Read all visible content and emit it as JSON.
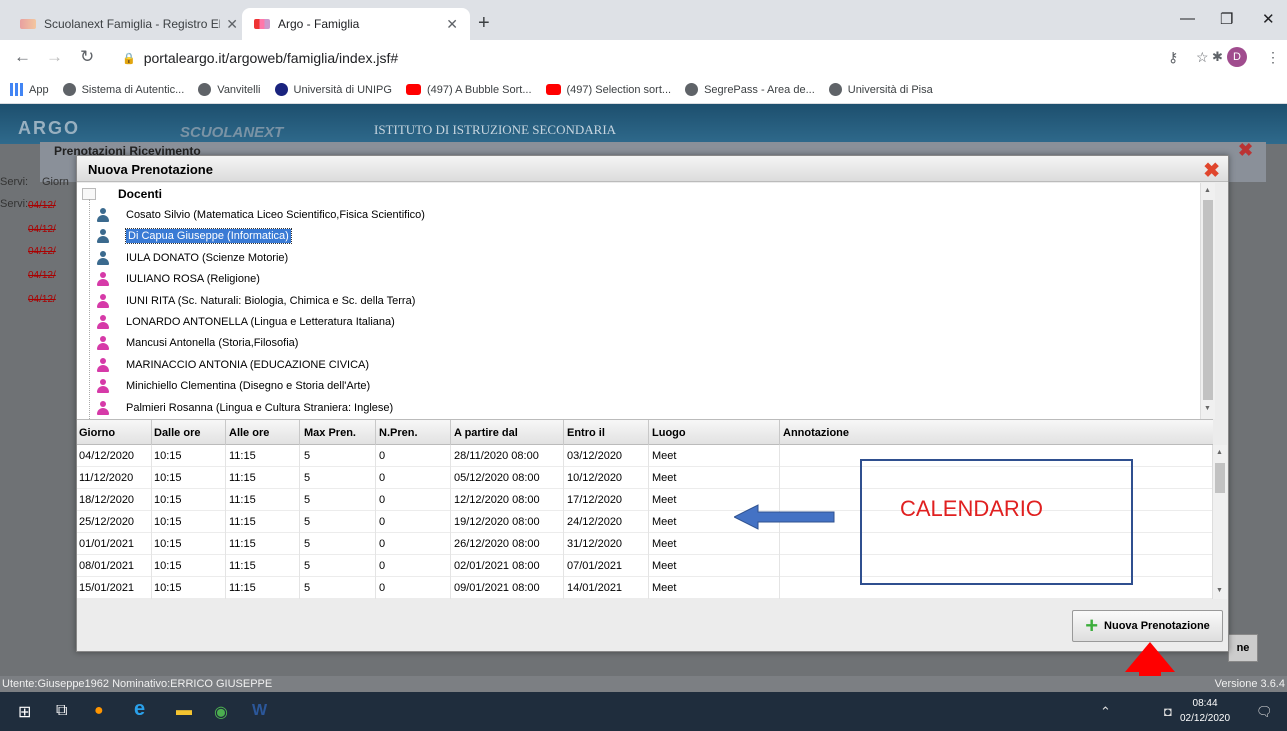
{
  "browser": {
    "tabs": [
      {
        "title": "Scuolanext Famiglia - Registro El",
        "active": false
      },
      {
        "title": "Argo - Famiglia",
        "active": true
      }
    ],
    "url": "portaleargo.it/argoweb/famiglia/index.jsf#",
    "avatar_letter": "D",
    "bookmarks": [
      "App",
      "Sistema di Autentic...",
      "Vanvitelli",
      "Università di UNIPG",
      "(497) A Bubble Sort...",
      "(497) Selection sort...",
      "SegrePass - Area de...",
      "Università di Pisa"
    ]
  },
  "app": {
    "logo": "ARGO",
    "logo_sub": "SCUOLANEXT",
    "institute": "ISTITUTO DI ISTRUZIONE SECONDARIA",
    "background_panel_title": "Prenotazioni Ricevimento",
    "left_labels": [
      "Servi:",
      "Giorn",
      "Servi:"
    ],
    "left_dates": [
      "04/12/",
      "04/12/",
      "04/12/",
      "04/12/",
      "04/12/"
    ],
    "bg_button_label": "ne"
  },
  "modal": {
    "title": "Nuova Prenotazione",
    "tree_root": "Docenti",
    "teachers": [
      {
        "name": "Cosato Silvio (Matematica Liceo Scientifico,Fisica Scientifico)",
        "gender": "m"
      },
      {
        "name": "Di Capua Giuseppe (Informatica)",
        "gender": "m",
        "selected": true
      },
      {
        "name": "IULA DONATO (Scienze Motorie)",
        "gender": "m"
      },
      {
        "name": "IULIANO ROSA (Religione)",
        "gender": "f"
      },
      {
        "name": "IUNI RITA (Sc. Naturali: Biologia, Chimica e Sc. della Terra)",
        "gender": "f"
      },
      {
        "name": "LONARDO ANTONELLA (Lingua e Letteratura Italiana)",
        "gender": "f"
      },
      {
        "name": "Mancusi Antonella (Storia,Filosofia)",
        "gender": "f"
      },
      {
        "name": "MARINACCIO ANTONIA (EDUCAZIONE CIVICA)",
        "gender": "f"
      },
      {
        "name": "Minichiello Clementina (Disegno e Storia dell'Arte)",
        "gender": "f"
      },
      {
        "name": "Palmieri Rosanna (Lingua e Cultura Straniera: Inglese)",
        "gender": "f"
      }
    ],
    "columns": [
      "Giorno",
      "Dalle ore",
      "Alle ore",
      "Max Pren.",
      "N.Pren.",
      "A partire dal",
      "Entro il",
      "Luogo",
      "Annotazione"
    ],
    "rows": [
      [
        "04/12/2020",
        "10:15",
        "11:15",
        "5",
        "0",
        "28/11/2020 08:00",
        "03/12/2020",
        "Meet",
        ""
      ],
      [
        "11/12/2020",
        "10:15",
        "11:15",
        "5",
        "0",
        "05/12/2020 08:00",
        "10/12/2020",
        "Meet",
        ""
      ],
      [
        "18/12/2020",
        "10:15",
        "11:15",
        "5",
        "0",
        "12/12/2020 08:00",
        "17/12/2020",
        "Meet",
        ""
      ],
      [
        "25/12/2020",
        "10:15",
        "11:15",
        "5",
        "0",
        "19/12/2020 08:00",
        "24/12/2020",
        "Meet",
        ""
      ],
      [
        "01/01/2021",
        "10:15",
        "11:15",
        "5",
        "0",
        "26/12/2020 08:00",
        "31/12/2020",
        "Meet",
        ""
      ],
      [
        "08/01/2021",
        "10:15",
        "11:15",
        "5",
        "0",
        "02/01/2021 08:00",
        "07/01/2021",
        "Meet",
        ""
      ],
      [
        "15/01/2021",
        "10:15",
        "11:15",
        "5",
        "0",
        "09/01/2021 08:00",
        "14/01/2021",
        "Meet",
        ""
      ]
    ],
    "button_label": "Nuova Prenotazione"
  },
  "annotations": {
    "calendar_label": "CALENDARIO",
    "arrow_color": "#4472c4",
    "highlight_color": "#ff0000"
  },
  "status": {
    "user": "Utente:Giuseppe1962 Nominativo:ERRICO GIUSEPPE",
    "version": "Versione 3.6.4"
  },
  "taskbar": {
    "time": "08:44",
    "date": "02/12/2020"
  },
  "colors": {
    "male_icon": "#3b6a8e",
    "female_icon": "#d63aa8",
    "selection": "#3a7bd5",
    "close_x": "#e0452c"
  }
}
